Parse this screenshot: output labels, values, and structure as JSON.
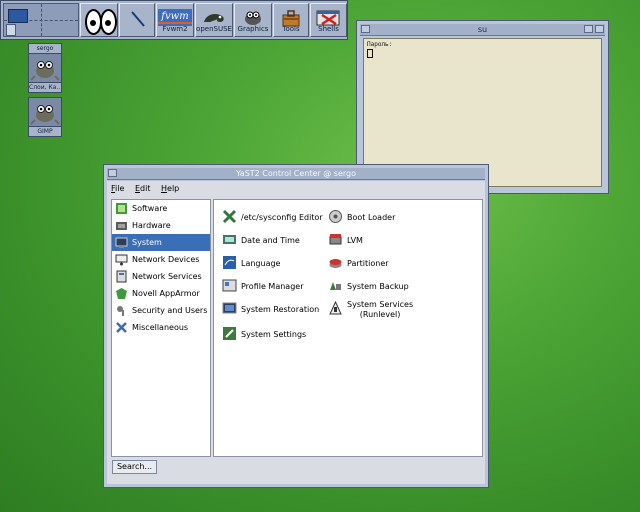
{
  "panel": {
    "pager_label": "sergo",
    "buttons": [
      {
        "label": "Fvwm2",
        "icon": "fvwm-logo-icon",
        "logo_text": "fvwm"
      },
      {
        "label": "openSUSE",
        "icon": "chameleon-icon"
      },
      {
        "label": "Graphics",
        "icon": "graphics-icon"
      },
      {
        "label": "Tools",
        "icon": "toolbox-icon"
      },
      {
        "label": "Shells",
        "icon": "terminal-icon"
      }
    ]
  },
  "desktop_icons": [
    {
      "title": "sergo",
      "caption": "Слои, Ка…"
    },
    {
      "title": "",
      "caption": "GIMP"
    }
  ],
  "su_window": {
    "title": "su",
    "prompt": "Пароль:"
  },
  "yast": {
    "title": "YaST2 Control Center @ sergo",
    "menu": [
      {
        "accel": "F",
        "rest": "ile"
      },
      {
        "accel": "E",
        "rest": "dit"
      },
      {
        "accel": "H",
        "rest": "elp"
      }
    ],
    "categories": [
      {
        "label": "Software",
        "icon": "software-icon",
        "selected": false
      },
      {
        "label": "Hardware",
        "icon": "hardware-icon",
        "selected": false
      },
      {
        "label": "System",
        "icon": "system-icon",
        "selected": true
      },
      {
        "label": "Network Devices",
        "icon": "network-devices-icon",
        "selected": false
      },
      {
        "label": "Network Services",
        "icon": "network-services-icon",
        "selected": false
      },
      {
        "label": "Novell AppArmor",
        "icon": "apparmor-icon",
        "selected": false
      },
      {
        "label": "Security and Users",
        "icon": "security-users-icon",
        "selected": false
      },
      {
        "label": "Miscellaneous",
        "icon": "miscellaneous-icon",
        "selected": false
      }
    ],
    "modules_left": [
      {
        "label": "/etc/sysconfig Editor",
        "icon": "sysconfig-editor-icon"
      },
      {
        "label": "Date and Time",
        "icon": "date-time-icon"
      },
      {
        "label": "Language",
        "icon": "language-icon"
      },
      {
        "label": "Profile Manager",
        "icon": "profile-manager-icon"
      },
      {
        "label": "System Restoration",
        "icon": "system-restoration-icon"
      },
      {
        "label": "System Settings",
        "icon": "system-settings-icon"
      }
    ],
    "modules_right": [
      {
        "label": "Boot Loader",
        "icon": "boot-loader-icon"
      },
      {
        "label": "LVM",
        "icon": "lvm-icon"
      },
      {
        "label": "Partitioner",
        "icon": "partitioner-icon"
      },
      {
        "label": "System Backup",
        "icon": "system-backup-icon"
      },
      {
        "label": "System Services",
        "label2": "(Runlevel)",
        "icon": "system-services-icon"
      }
    ],
    "search_label": "Search..."
  },
  "colors": {
    "desktop": "#4da636",
    "selection": "#3a6fb7",
    "panel": "#a7b4c9"
  }
}
